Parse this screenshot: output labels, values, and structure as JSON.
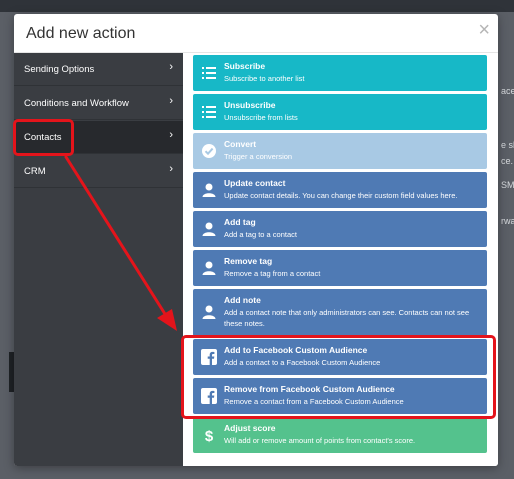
{
  "modal": {
    "title": "Add new action",
    "close_glyph": "×"
  },
  "sidebar": {
    "items": [
      {
        "label": "Sending Options",
        "chevron": "›"
      },
      {
        "label": "Conditions and Workflow",
        "chevron": "›"
      },
      {
        "label": "Contacts",
        "chevron": "›"
      },
      {
        "label": "CRM",
        "chevron": "›"
      }
    ]
  },
  "actions": [
    {
      "title": "Subscribe",
      "desc": "Subscribe to another list",
      "icon": "list-icon",
      "color": "#17b8c7"
    },
    {
      "title": "Unsubscribe",
      "desc": "Unsubscribe from lists",
      "icon": "list-icon",
      "color": "#17b8c7"
    },
    {
      "title": "Convert",
      "desc": "Trigger a conversion",
      "icon": "check-circle-icon",
      "color": "#a8c9e4"
    },
    {
      "title": "Update contact",
      "desc": "Update contact details. You can change their custom field values here.",
      "icon": "user-icon",
      "color": "#4f7ab4"
    },
    {
      "title": "Add tag",
      "desc": "Add a tag to a contact",
      "icon": "user-icon",
      "color": "#4f7ab4"
    },
    {
      "title": "Remove tag",
      "desc": "Remove a tag from a contact",
      "icon": "user-icon",
      "color": "#4f7ab4"
    },
    {
      "title": "Add note",
      "desc": "Add a contact note that only administrators can see. Contacts can not see these notes.",
      "icon": "user-icon",
      "color": "#4f7ab4"
    },
    {
      "title": "Add to Facebook Custom Audience",
      "desc": "Add a contact to a Facebook Custom Audience",
      "icon": "facebook-icon",
      "color": "#4f7ab4"
    },
    {
      "title": "Remove from Facebook Custom Audience",
      "desc": "Remove a contact from a Facebook Custom Audience",
      "icon": "facebook-icon",
      "color": "#4f7ab4"
    },
    {
      "title": "Adjust score",
      "desc": "Will add or remove amount of points from contact's score.",
      "icon": "dollar-icon",
      "color": "#54c28d"
    }
  ],
  "background": {
    "peek_texts": [
      "ace",
      "e sk",
      "ce.",
      "SMS",
      "rwarc"
    ]
  },
  "annotations": {
    "highlight_color": "#e4141b"
  }
}
